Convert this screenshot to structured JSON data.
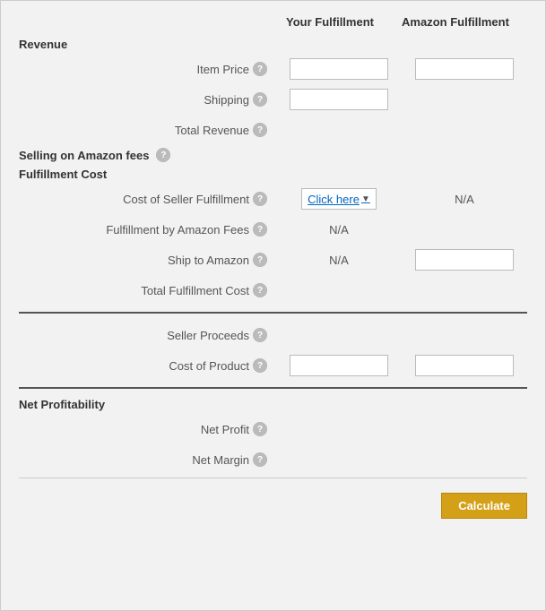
{
  "header": {
    "col1": "Your Fulfillment",
    "col2": "Amazon Fulfillment"
  },
  "sections": {
    "revenue": {
      "title": "Revenue",
      "rows": [
        {
          "label": "Item Price",
          "hasInfo": true,
          "col1": "input",
          "col2": "input"
        },
        {
          "label": "Shipping",
          "hasInfo": true,
          "col1": "input",
          "col2": ""
        },
        {
          "label": "Total Revenue",
          "hasInfo": true,
          "col1": "",
          "col2": ""
        }
      ]
    },
    "sellingFees": {
      "title": "Selling on Amazon fees",
      "hasInfo": true
    },
    "fulfillmentCost": {
      "title": "Fulfillment Cost",
      "rows": [
        {
          "label": "Cost of Seller Fulfillment",
          "hasInfo": true,
          "col1": "clickhere",
          "col2": "N/A"
        },
        {
          "label": "Fulfillment by Amazon Fees",
          "hasInfo": true,
          "col1": "N/A",
          "col2": ""
        },
        {
          "label": "Ship to Amazon",
          "hasInfo": true,
          "col1": "N/A",
          "col2": "input"
        },
        {
          "label": "Total Fulfillment Cost",
          "hasInfo": true,
          "col1": "",
          "col2": ""
        }
      ]
    },
    "sellerProceeds": {
      "title": "Seller Proceeds",
      "hasInfo": true
    },
    "costOfProduct": {
      "label": "Cost of Product",
      "hasInfo": true,
      "col1": "input",
      "col2": "input"
    },
    "netProfitability": {
      "title": "Net Profitability",
      "rows": [
        {
          "label": "Net Profit",
          "hasInfo": true
        },
        {
          "label": "Net Margin",
          "hasInfo": true
        }
      ]
    }
  },
  "buttons": {
    "clickHere": "Click here",
    "calculate": "Calculate"
  }
}
